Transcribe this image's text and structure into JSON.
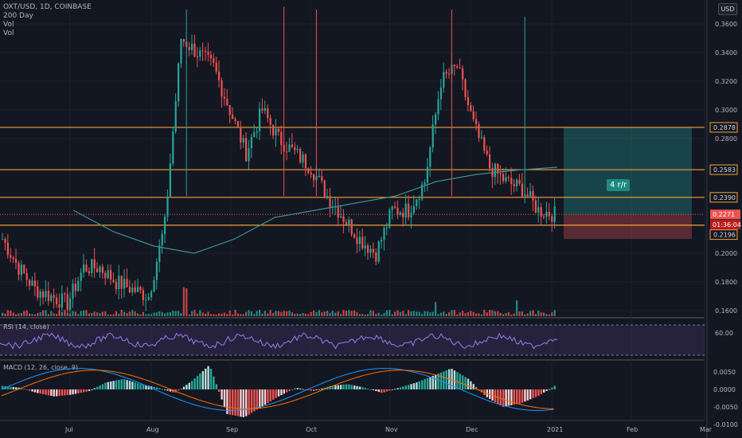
{
  "header": {
    "symbol": "OXT/USD, 1D, COINBASE",
    "ma_label": "200 Day",
    "vol1": "Vol",
    "vol2": "Vol",
    "currency_button": "USD"
  },
  "position_tool": {
    "label": "4 r/r",
    "entry": 0.2271,
    "target": 0.2878,
    "stop": 0.21
  },
  "price_axis": {
    "ticks": [
      "0.3600",
      "0.3400",
      "0.3200",
      "0.3000",
      "0.2800",
      "0.2000",
      "0.1800",
      "0.1600"
    ]
  },
  "price_tags": [
    {
      "text": "0.2878",
      "value": 0.2878,
      "kind": "level"
    },
    {
      "text": "0.2583",
      "value": 0.2583,
      "kind": "level"
    },
    {
      "text": "0.2390",
      "value": 0.239,
      "kind": "level"
    },
    {
      "text": "0.2271",
      "value": 0.2271,
      "kind": "last"
    },
    {
      "text": "01:36:04",
      "value": 0.22,
      "kind": "countdown"
    },
    {
      "text": "0.2196",
      "value": 0.213,
      "kind": "level"
    }
  ],
  "rsi": {
    "label": "RSI (14, close)",
    "tick": "60.00"
  },
  "macd": {
    "label": "MACD (12, 26, close, 9)",
    "ticks": [
      "0.0050",
      "0.0000",
      "-0.0050",
      "-0.0100"
    ]
  },
  "time_axis": {
    "labels": [
      "Jul",
      "Aug",
      "Sep",
      "Oct",
      "Nov",
      "Dec",
      "2021",
      "Feb",
      "Mar"
    ]
  },
  "colors": {
    "up": "#26a69a",
    "down": "#ef5350",
    "level": "#f7a13b",
    "ma": "#3d8f8f",
    "rsi": "#7e57c2"
  },
  "chart_data": {
    "type": "candlestick",
    "title": "OXT/USD, 1D, COINBASE",
    "ylim": [
      0.155,
      0.375
    ],
    "x": [
      "Jul",
      "Aug",
      "Sep",
      "Oct",
      "Nov",
      "Dec",
      "2021"
    ],
    "close_trace": [
      0.21,
      0.19,
      0.175,
      0.17,
      0.165,
      0.19,
      0.19,
      0.18,
      0.175,
      0.17,
      0.22,
      0.35,
      0.34,
      0.33,
      0.3,
      0.27,
      0.3,
      0.28,
      0.27,
      0.26,
      0.24,
      0.225,
      0.21,
      0.2,
      0.23,
      0.23,
      0.25,
      0.32,
      0.33,
      0.29,
      0.26,
      0.25,
      0.245,
      0.23,
      0.2271
    ],
    "ma_200": [
      0.23,
      0.215,
      0.205,
      0.2,
      0.21,
      0.225,
      0.23,
      0.235,
      0.24,
      0.25,
      0.255,
      0.258,
      0.26
    ],
    "levels": [
      0.2878,
      0.2583,
      0.239,
      0.2196
    ],
    "last": 0.2271
  }
}
